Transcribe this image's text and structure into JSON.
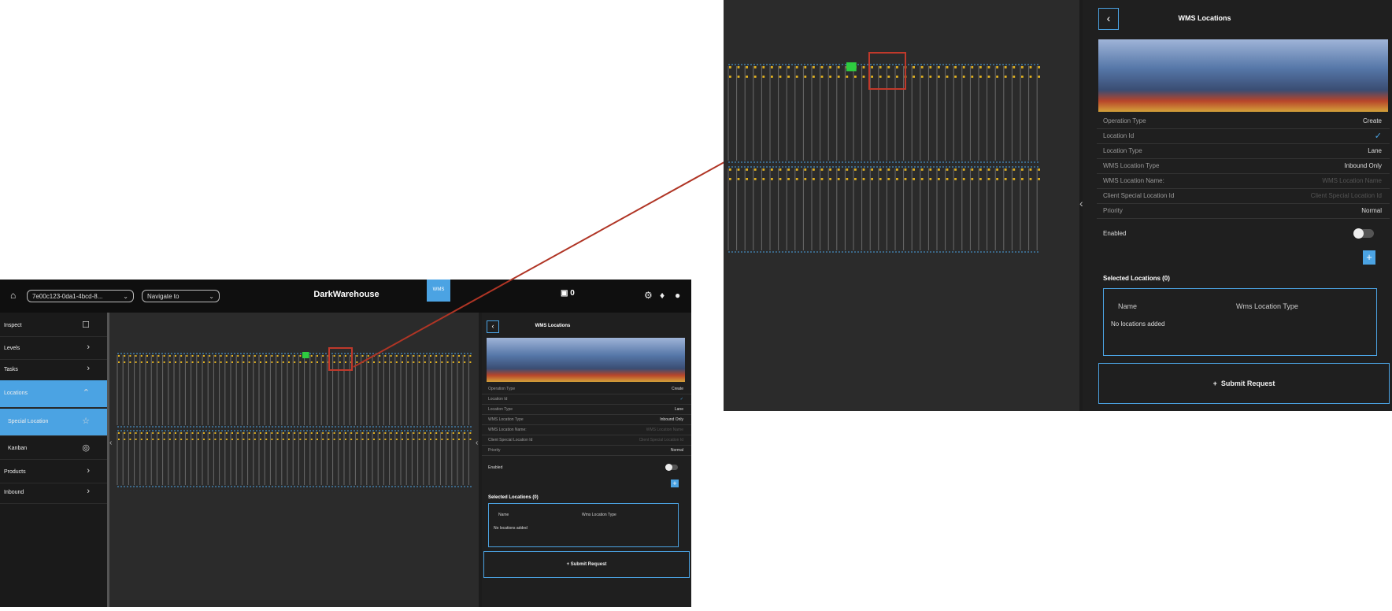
{
  "header": {
    "home_icon": "home-icon",
    "tenant_select": "7e00c123-0da1-4bcd-8...",
    "navigate_placeholder": "Navigate to",
    "brand": "DarkWarehouse",
    "wms_badge": "WMS",
    "robot_count": "0"
  },
  "sidebar": {
    "items": [
      {
        "label": "Inspect",
        "icon": "clipboard-icon"
      },
      {
        "label": "Levels",
        "icon": "chevron-right-icon"
      },
      {
        "label": "Tasks",
        "icon": "chevron-right-icon"
      },
      {
        "label": "Locations",
        "icon": "chevron-up-icon"
      },
      {
        "label": "Special Location",
        "icon": "star-icon"
      },
      {
        "label": "Kanban",
        "icon": "target-icon"
      },
      {
        "label": "Products",
        "icon": "chevron-right-icon"
      },
      {
        "label": "Inbound",
        "icon": "chevron-right-icon"
      }
    ]
  },
  "panel": {
    "title": "WMS Locations",
    "fields": [
      {
        "label": "Operation Type",
        "value": "Create"
      },
      {
        "label": "Location Id",
        "value": ""
      },
      {
        "label": "Location Type",
        "value": "Lane"
      },
      {
        "label": "WMS Location Type",
        "value": "Inbound Only"
      },
      {
        "label": "WMS Location Name:",
        "value": "WMS Location Name"
      },
      {
        "label": "Client Special Location Id",
        "value": "Client Special Location Id"
      },
      {
        "label": "Priority",
        "value": "Normal"
      }
    ],
    "enabled_label": "Enabled",
    "enabled": false,
    "selected_title": "Selected Locations (0)",
    "table_headers": [
      "Name",
      "Wms Location Type"
    ],
    "empty_text": "No locations added",
    "submit_label": "Submit Request"
  },
  "colors": {
    "accent": "#4ba3e3",
    "highlight": "#c0392b",
    "selected_lane": "#2ecc40"
  }
}
